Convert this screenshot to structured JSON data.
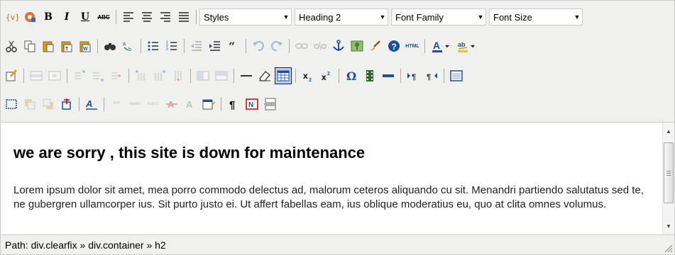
{
  "toolbar": {
    "styles_value": "Styles",
    "format_value": "Heading 2",
    "font_family_value": "Font Family",
    "font_size_value": "Font Size",
    "bold_label": "B",
    "italic_label": "I",
    "underline_label": "U",
    "strike_label": "ABC",
    "html_label": "HTML",
    "cite_label": "“”",
    "abbr_label": "ABBR",
    "acronym_label": "A.B.C.",
    "colors": {
      "accent": "#0a246a",
      "red": "#cc0000",
      "blue": "#1a4fa0",
      "green": "#2f8a2f",
      "gold": "#d4a017"
    }
  },
  "content": {
    "heading": "we are sorry , this site is down for maintenance",
    "paragraph": "Lorem ipsum dolor sit amet, mea porro commodo delectus ad, malorum ceteros aliquando cu sit. Menandri partiendo salutatus sed te, ne gubergren ullamcorper ius. Sit purto justo ei. Ut affert fabellas eam, ius oblique moderatius eu, quo at clita omnes volumus."
  },
  "statusbar": {
    "path": "Path: div.clearfix » div.container » h2"
  }
}
